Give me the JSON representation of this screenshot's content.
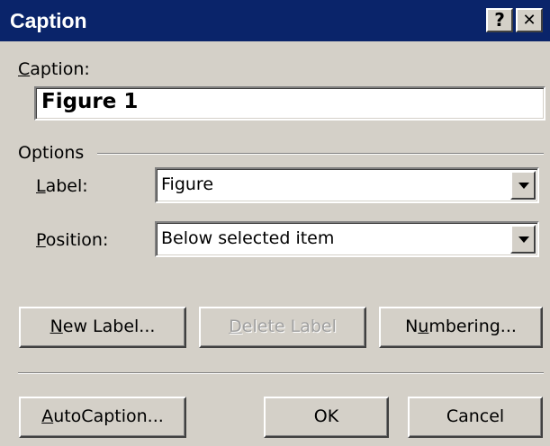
{
  "window": {
    "title": "Caption",
    "help_button": "?",
    "close_button": "✕"
  },
  "caption": {
    "label_prefix": "",
    "label_accel": "C",
    "label_rest": "aption:",
    "value": "Figure 1"
  },
  "options": {
    "group_label": "Options",
    "label_field": {
      "label_accel": "L",
      "label_rest": "abel:",
      "value": "Figure"
    },
    "position_field": {
      "label_accel": "P",
      "label_rest": "osition:",
      "value": "Below selected item"
    }
  },
  "buttons": {
    "new_label": {
      "accel": "N",
      "rest": "ew Label..."
    },
    "delete_label": {
      "accel": "D",
      "rest": "elete Label"
    },
    "numbering": {
      "pre": "N",
      "accel": "u",
      "rest": "mbering..."
    },
    "autocaption": {
      "accel": "A",
      "rest": "utoCaption..."
    },
    "ok": "OK",
    "cancel": "Cancel"
  },
  "colors": {
    "titlebar": "#0a246a",
    "face": "#d4d0c8"
  }
}
